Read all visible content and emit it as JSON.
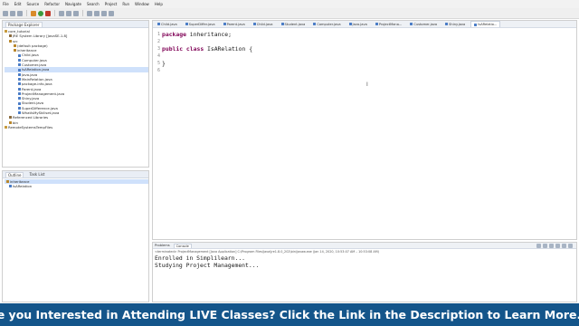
{
  "menu": [
    "File",
    "Edit",
    "Source",
    "Refactor",
    "Navigate",
    "Search",
    "Project",
    "Run",
    "Window",
    "Help"
  ],
  "explorer": {
    "tab_label": "Package Explorer",
    "items": [
      {
        "label": "core_tutorial",
        "kind": "proj",
        "indent": 0
      },
      {
        "label": "JRE System Library [JavaSE-1.8]",
        "kind": "lib",
        "indent": 1
      },
      {
        "label": "src",
        "kind": "pkg",
        "indent": 1
      },
      {
        "label": "(default package)",
        "kind": "pkg",
        "indent": 2
      },
      {
        "label": "inheritance",
        "kind": "pkg",
        "indent": 2
      },
      {
        "label": "Child.java",
        "kind": "java",
        "indent": 3
      },
      {
        "label": "Computer.java",
        "kind": "java",
        "indent": 3
      },
      {
        "label": "Customer.java",
        "kind": "java",
        "indent": 3
      },
      {
        "label": "IsARelation.java",
        "kind": "java",
        "indent": 3,
        "selected": true
      },
      {
        "label": "Java.java",
        "kind": "java",
        "indent": 3
      },
      {
        "label": "MainRelation.java",
        "kind": "java",
        "indent": 3
      },
      {
        "label": "package-info.java",
        "kind": "java",
        "indent": 3
      },
      {
        "label": "Parent.java",
        "kind": "java",
        "indent": 3
      },
      {
        "label": "ProjectManagement.java",
        "kind": "java",
        "indent": 3
      },
      {
        "label": "Shiny.java",
        "kind": "java",
        "indent": 3
      },
      {
        "label": "Student.java",
        "kind": "java",
        "indent": 3
      },
      {
        "label": "SuperDifference.java",
        "kind": "java",
        "indent": 3
      },
      {
        "label": "WhatIsMySkillset.java",
        "kind": "java",
        "indent": 3
      },
      {
        "label": "Referenced Libraries",
        "kind": "lib",
        "indent": 1
      },
      {
        "label": "bin",
        "kind": "pkg",
        "indent": 1
      },
      {
        "label": "RemoteSystemsTempFiles",
        "kind": "proj",
        "indent": 0
      }
    ]
  },
  "outline": {
    "tabs": [
      "Outline",
      "Task List"
    ],
    "items": [
      {
        "label": "inheritance",
        "kind": "pkg",
        "selected": true
      },
      {
        "label": "IsARelation",
        "kind": "java",
        "selected": false
      }
    ]
  },
  "editor": {
    "tabs": [
      {
        "label": "Child.java",
        "active": false
      },
      {
        "label": "SuperDiffer.java",
        "active": false
      },
      {
        "label": "Parent.java",
        "active": false
      },
      {
        "label": "Child.java",
        "active": false
      },
      {
        "label": "Student.java",
        "active": false
      },
      {
        "label": "Computer.java",
        "active": false
      },
      {
        "label": "Java.java",
        "active": false
      },
      {
        "label": "ProjectMana...",
        "active": false
      },
      {
        "label": "Customer.java",
        "active": false
      },
      {
        "label": "Shiny.java",
        "active": false
      },
      {
        "label": "IsARelatio...",
        "active": true
      }
    ],
    "lines": [
      {
        "n": "1",
        "kw": "package",
        "rest": " inheritance;"
      },
      {
        "n": "2",
        "kw": "",
        "rest": ""
      },
      {
        "n": "3",
        "kw": "public class",
        "rest": " IsARelation {"
      },
      {
        "n": "4",
        "kw": "",
        "rest": ""
      },
      {
        "n": "5",
        "kw": "",
        "rest": "}"
      },
      {
        "n": "6",
        "kw": "",
        "rest": ""
      }
    ]
  },
  "console": {
    "tabs": [
      "Problems",
      "Console"
    ],
    "header": "<terminated> ProjectManagement [Java Application] C:\\Program Files\\Java\\jre1.8.0_202\\bin\\javaw.exe (Jan 14, 2020, 10:53:07 AM – 10:53:08 AM)",
    "lines": [
      "Enrolled in Simplilearn...",
      "Studying Project Management..."
    ]
  },
  "banner": {
    "text": "Are you Interested in Attending LIVE Classes? Click the Link in the Description to Learn More.",
    "arrow": "⬇"
  }
}
